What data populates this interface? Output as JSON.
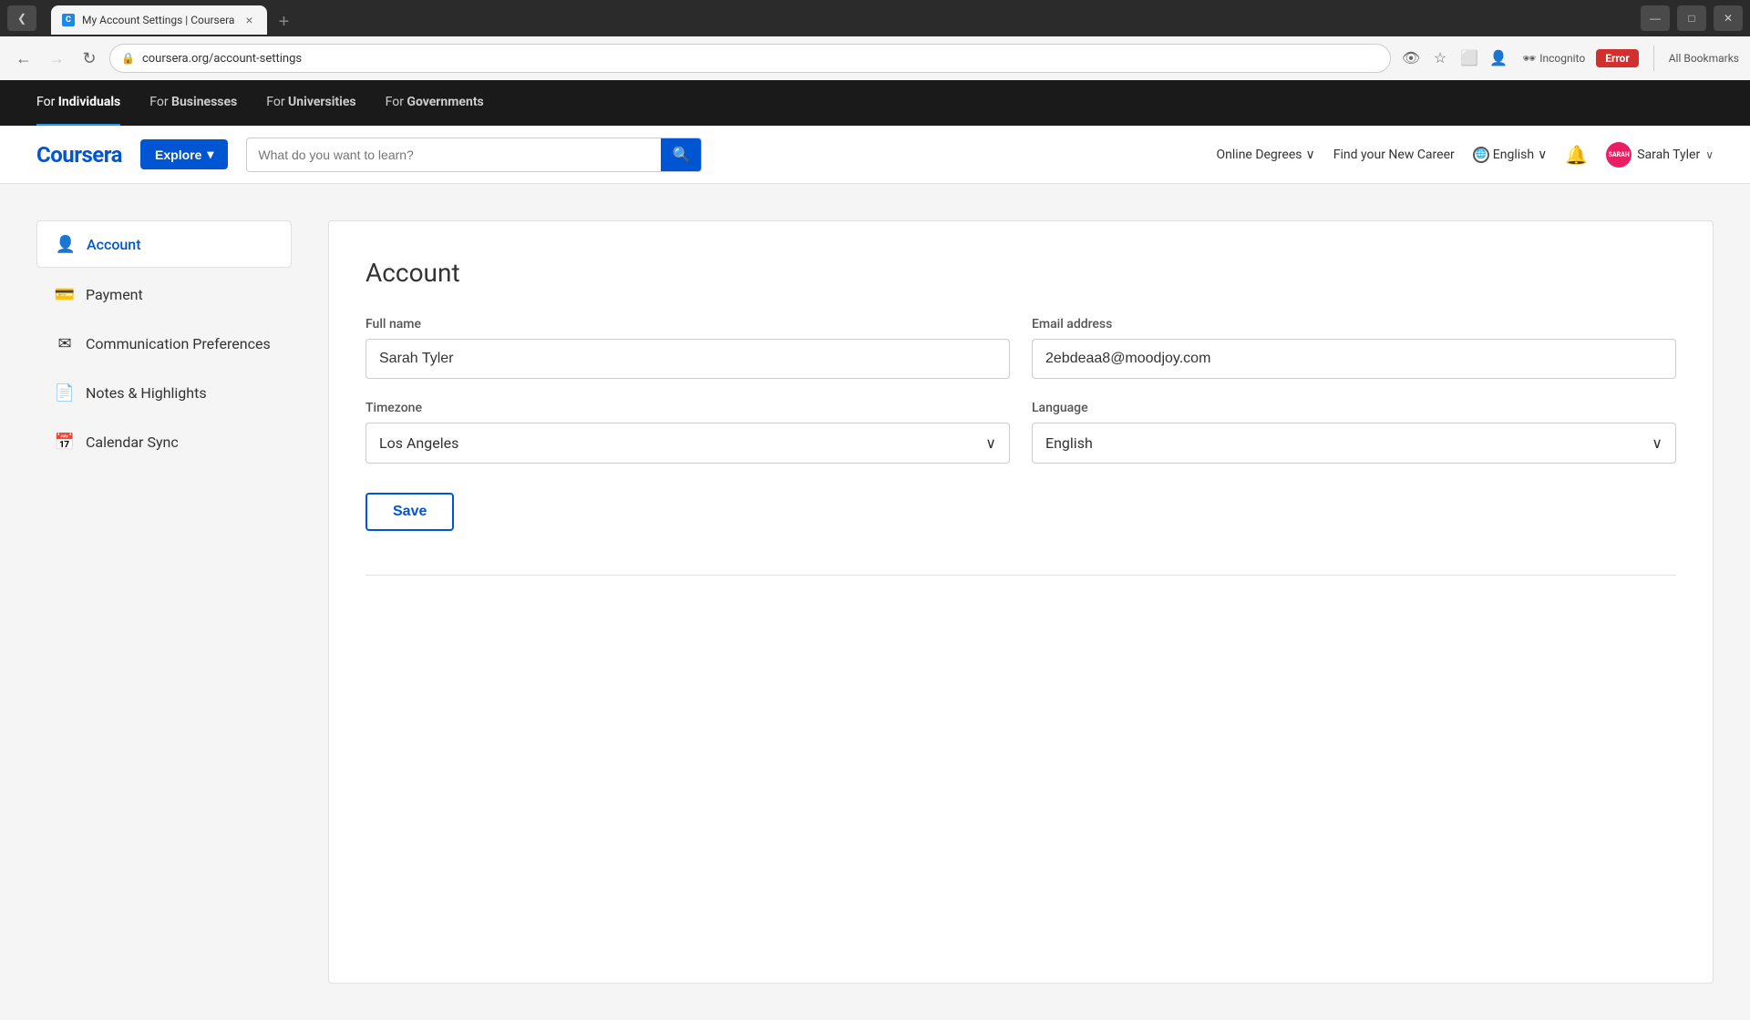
{
  "browser": {
    "tab": {
      "favicon": "C",
      "title": "My Account Settings | Coursera",
      "close_icon": "×"
    },
    "new_tab_icon": "+",
    "nav": {
      "back_icon": "←",
      "forward_icon": "→",
      "refresh_icon": "↻",
      "address": "coursera.org/account-settings",
      "eye_icon": "👁",
      "star_icon": "☆",
      "tablet_icon": "⬜",
      "incognito_label": "Incognito",
      "error_label": "Error",
      "bookmarks_label": "All Bookmarks",
      "profile_icon": "👤"
    }
  },
  "site": {
    "top_nav": {
      "items": [
        {
          "label": "For ",
          "bold": "Individuals",
          "active": true
        },
        {
          "label": "For ",
          "bold": "Businesses",
          "active": false
        },
        {
          "label": "For ",
          "bold": "Universities",
          "active": false
        },
        {
          "label": "For ",
          "bold": "Governments",
          "active": false
        }
      ]
    },
    "header": {
      "logo": "Coursera",
      "explore_label": "Explore",
      "explore_chevron": "▾",
      "search_placeholder": "What do you want to learn?",
      "search_icon": "🔍",
      "online_degrees_label": "Online Degrees",
      "online_degrees_chevron": "∨",
      "new_career_label": "Find your New Career",
      "lang_label": "English",
      "lang_chevron": "∨",
      "bell_icon": "🔔",
      "user_initials": "SARAH",
      "user_name": "Sarah Tyler",
      "user_chevron": "∨"
    },
    "sidebar": {
      "items": [
        {
          "icon": "👤",
          "label": "Account",
          "active": true
        },
        {
          "icon": "💳",
          "label": "Payment",
          "active": false
        },
        {
          "icon": "✉",
          "label": "Communication Preferences",
          "active": false
        },
        {
          "icon": "📄",
          "label": "Notes & Highlights",
          "active": false
        },
        {
          "icon": "📅",
          "label": "Calendar Sync",
          "active": false
        }
      ]
    },
    "account": {
      "title": "Account",
      "full_name_label": "Full name",
      "full_name_value": "Sarah Tyler",
      "email_label": "Email address",
      "email_value": "2ebdeaa8@moodjoy.com",
      "timezone_label": "Timezone",
      "timezone_value": "Los Angeles",
      "timezone_chevron": "∨",
      "language_label": "Language",
      "language_value": "English",
      "language_chevron": "∨",
      "save_label": "Save"
    }
  }
}
